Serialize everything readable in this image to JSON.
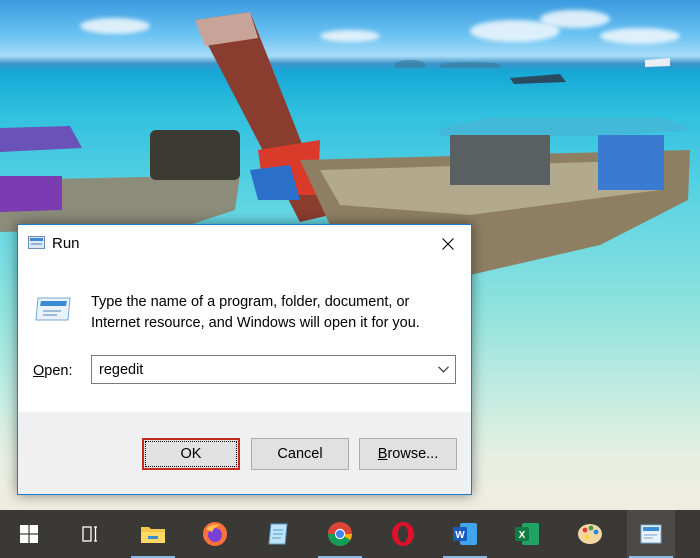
{
  "dialog": {
    "title": "Run",
    "description": "Type the name of a program, folder, document, or Internet resource, and Windows will open it for you.",
    "open_label_underlined": "O",
    "open_label_rest": "pen:",
    "input_value": "regedit",
    "ok_label": "OK",
    "cancel_label": "Cancel",
    "browse_label_underlined": "B",
    "browse_label_rest": "rowse..."
  },
  "taskbar": {
    "items": [
      {
        "name": "start-button",
        "icon": "windows-logo-icon"
      },
      {
        "name": "task-view-button",
        "icon": "task-view-icon"
      },
      {
        "name": "file-explorer",
        "icon": "folder-icon",
        "active": true
      },
      {
        "name": "firefox",
        "icon": "firefox-icon"
      },
      {
        "name": "notepad",
        "icon": "notepad-icon"
      },
      {
        "name": "chrome",
        "icon": "chrome-icon",
        "active": true
      },
      {
        "name": "opera",
        "icon": "opera-icon"
      },
      {
        "name": "word",
        "icon": "word-icon",
        "active": true
      },
      {
        "name": "excel",
        "icon": "excel-icon"
      },
      {
        "name": "paint",
        "icon": "paint-icon"
      },
      {
        "name": "run-app",
        "icon": "run-icon",
        "active": true
      }
    ]
  },
  "colors": {
    "accent": "#1a7bd7",
    "ok_border": "#c42b1c",
    "taskbar": "#3a3936",
    "active_indicator": "#8ab7e6"
  }
}
